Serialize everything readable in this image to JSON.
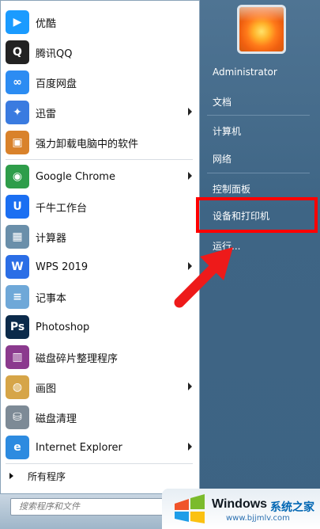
{
  "programs": [
    {
      "label": "优酷",
      "icon": "youku-icon",
      "color": "#1a9bff",
      "glyph": "▶",
      "arrow": false
    },
    {
      "label": "腾讯QQ",
      "icon": "qq-icon",
      "color": "#222222",
      "glyph": "Q",
      "arrow": false
    },
    {
      "label": "百度网盘",
      "icon": "baidu-netdisk-icon",
      "color": "#2c8cf2",
      "glyph": "∞",
      "arrow": false
    },
    {
      "label": "迅雷",
      "icon": "xunlei-icon",
      "color": "#3a7be0",
      "glyph": "✦",
      "arrow": true
    },
    {
      "label": "强力卸载电脑中的软件",
      "icon": "uninstall-box-icon",
      "color": "#d9822b",
      "glyph": "▣",
      "arrow": false
    },
    {
      "label": "Google Chrome",
      "icon": "chrome-icon",
      "color": "#2e9d4a",
      "glyph": "◉",
      "arrow": true
    },
    {
      "label": "千牛工作台",
      "icon": "qianniu-icon",
      "color": "#1b6ff2",
      "glyph": "U",
      "arrow": false
    },
    {
      "label": "计算器",
      "icon": "calculator-icon",
      "color": "#6a8faa",
      "glyph": "▦",
      "arrow": false
    },
    {
      "label": "WPS 2019",
      "icon": "wps-icon",
      "color": "#2b6ee6",
      "glyph": "W",
      "arrow": true
    },
    {
      "label": "记事本",
      "icon": "notepad-icon",
      "color": "#6fa8d8",
      "glyph": "≡",
      "arrow": false
    },
    {
      "label": "Photoshop",
      "icon": "photoshop-icon",
      "color": "#0b2a4a",
      "glyph": "Ps",
      "arrow": false
    },
    {
      "label": "磁盘碎片整理程序",
      "icon": "defrag-icon",
      "color": "#8b3a8e",
      "glyph": "▥",
      "arrow": false
    },
    {
      "label": "画图",
      "icon": "paint-icon",
      "color": "#d6a548",
      "glyph": "◍",
      "arrow": true
    },
    {
      "label": "磁盘清理",
      "icon": "disk-cleanup-icon",
      "color": "#7d8a96",
      "glyph": "⛁",
      "arrow": false
    },
    {
      "label": "Internet Explorer",
      "icon": "ie-icon",
      "color": "#2d8be0",
      "glyph": "e",
      "arrow": true
    }
  ],
  "all_programs": "所有程序",
  "search": {
    "placeholder": "搜索程序和文件"
  },
  "right_menu": [
    {
      "label": "Administrator",
      "name": "user-name"
    },
    {
      "label": "文档",
      "name": "documents"
    },
    {
      "label": "计算机",
      "name": "computer"
    },
    {
      "label": "网络",
      "name": "network"
    },
    {
      "label": "控制面板",
      "name": "control-panel"
    },
    {
      "label": "设备和打印机",
      "name": "devices-and-printers"
    },
    {
      "label": "运行...",
      "name": "run"
    }
  ],
  "watermark": {
    "brand": "Windows",
    "cn": "系统之家",
    "url": "www.bjjmlv.com"
  },
  "colors": {
    "highlight": "#ff0000",
    "panel": "#3e6585"
  }
}
